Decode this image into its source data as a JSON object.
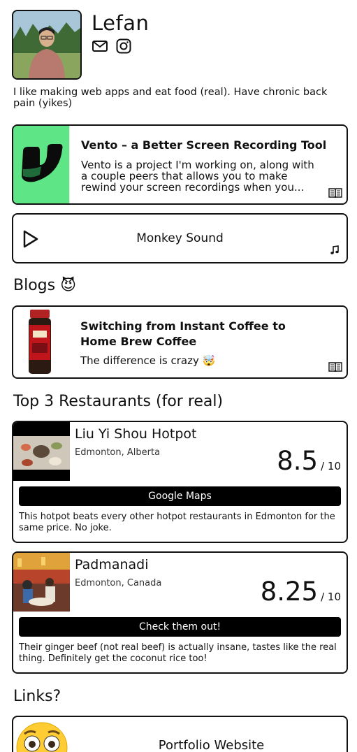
{
  "profile": {
    "name": "Lefan",
    "bio": "I like making web apps and eat food (real). Have chronic back pain (yikes)",
    "social": [
      "mail-icon",
      "instagram-icon"
    ]
  },
  "projects": [
    {
      "title": "Vento – a Better Screen Recording Tool",
      "desc": "Vento is a project I'm working on, along with a couple peers that allows you to make rewind your screen recordings when you...",
      "icon": "book-icon"
    }
  ],
  "music": {
    "label": "Monkey Sound",
    "icon": "music-note-icon"
  },
  "blogs": {
    "heading": "Blogs 😈",
    "items": [
      {
        "title": "Switching from Instant Coffee to Home Brew Coffee",
        "desc": "The difference is crazy 🤯"
      }
    ]
  },
  "restaurants": {
    "heading": "Top 3 Restaurants (for real)",
    "items": [
      {
        "name": "Liu Yi Shou Hotpot",
        "location": "Edmonton, Alberta",
        "score": "8.5",
        "out_of": "/ 10",
        "button": "Google Maps",
        "review": "This hotpot beats every other hotpot restaurants in Edmonton for the same price. No joke."
      },
      {
        "name": "Padmanadi",
        "location": "Edmonton, Canada",
        "score": "8.25",
        "out_of": "/ 10",
        "button": "Check them out!",
        "review": "Their ginger beef (not real beef) is actually insane, tastes like the real thing. Definitely get the coconut rice too!"
      }
    ]
  },
  "links": {
    "heading": "Links?",
    "items": [
      {
        "label": "Portfolio Website",
        "icon": "flushed-face-emoji"
      }
    ]
  }
}
